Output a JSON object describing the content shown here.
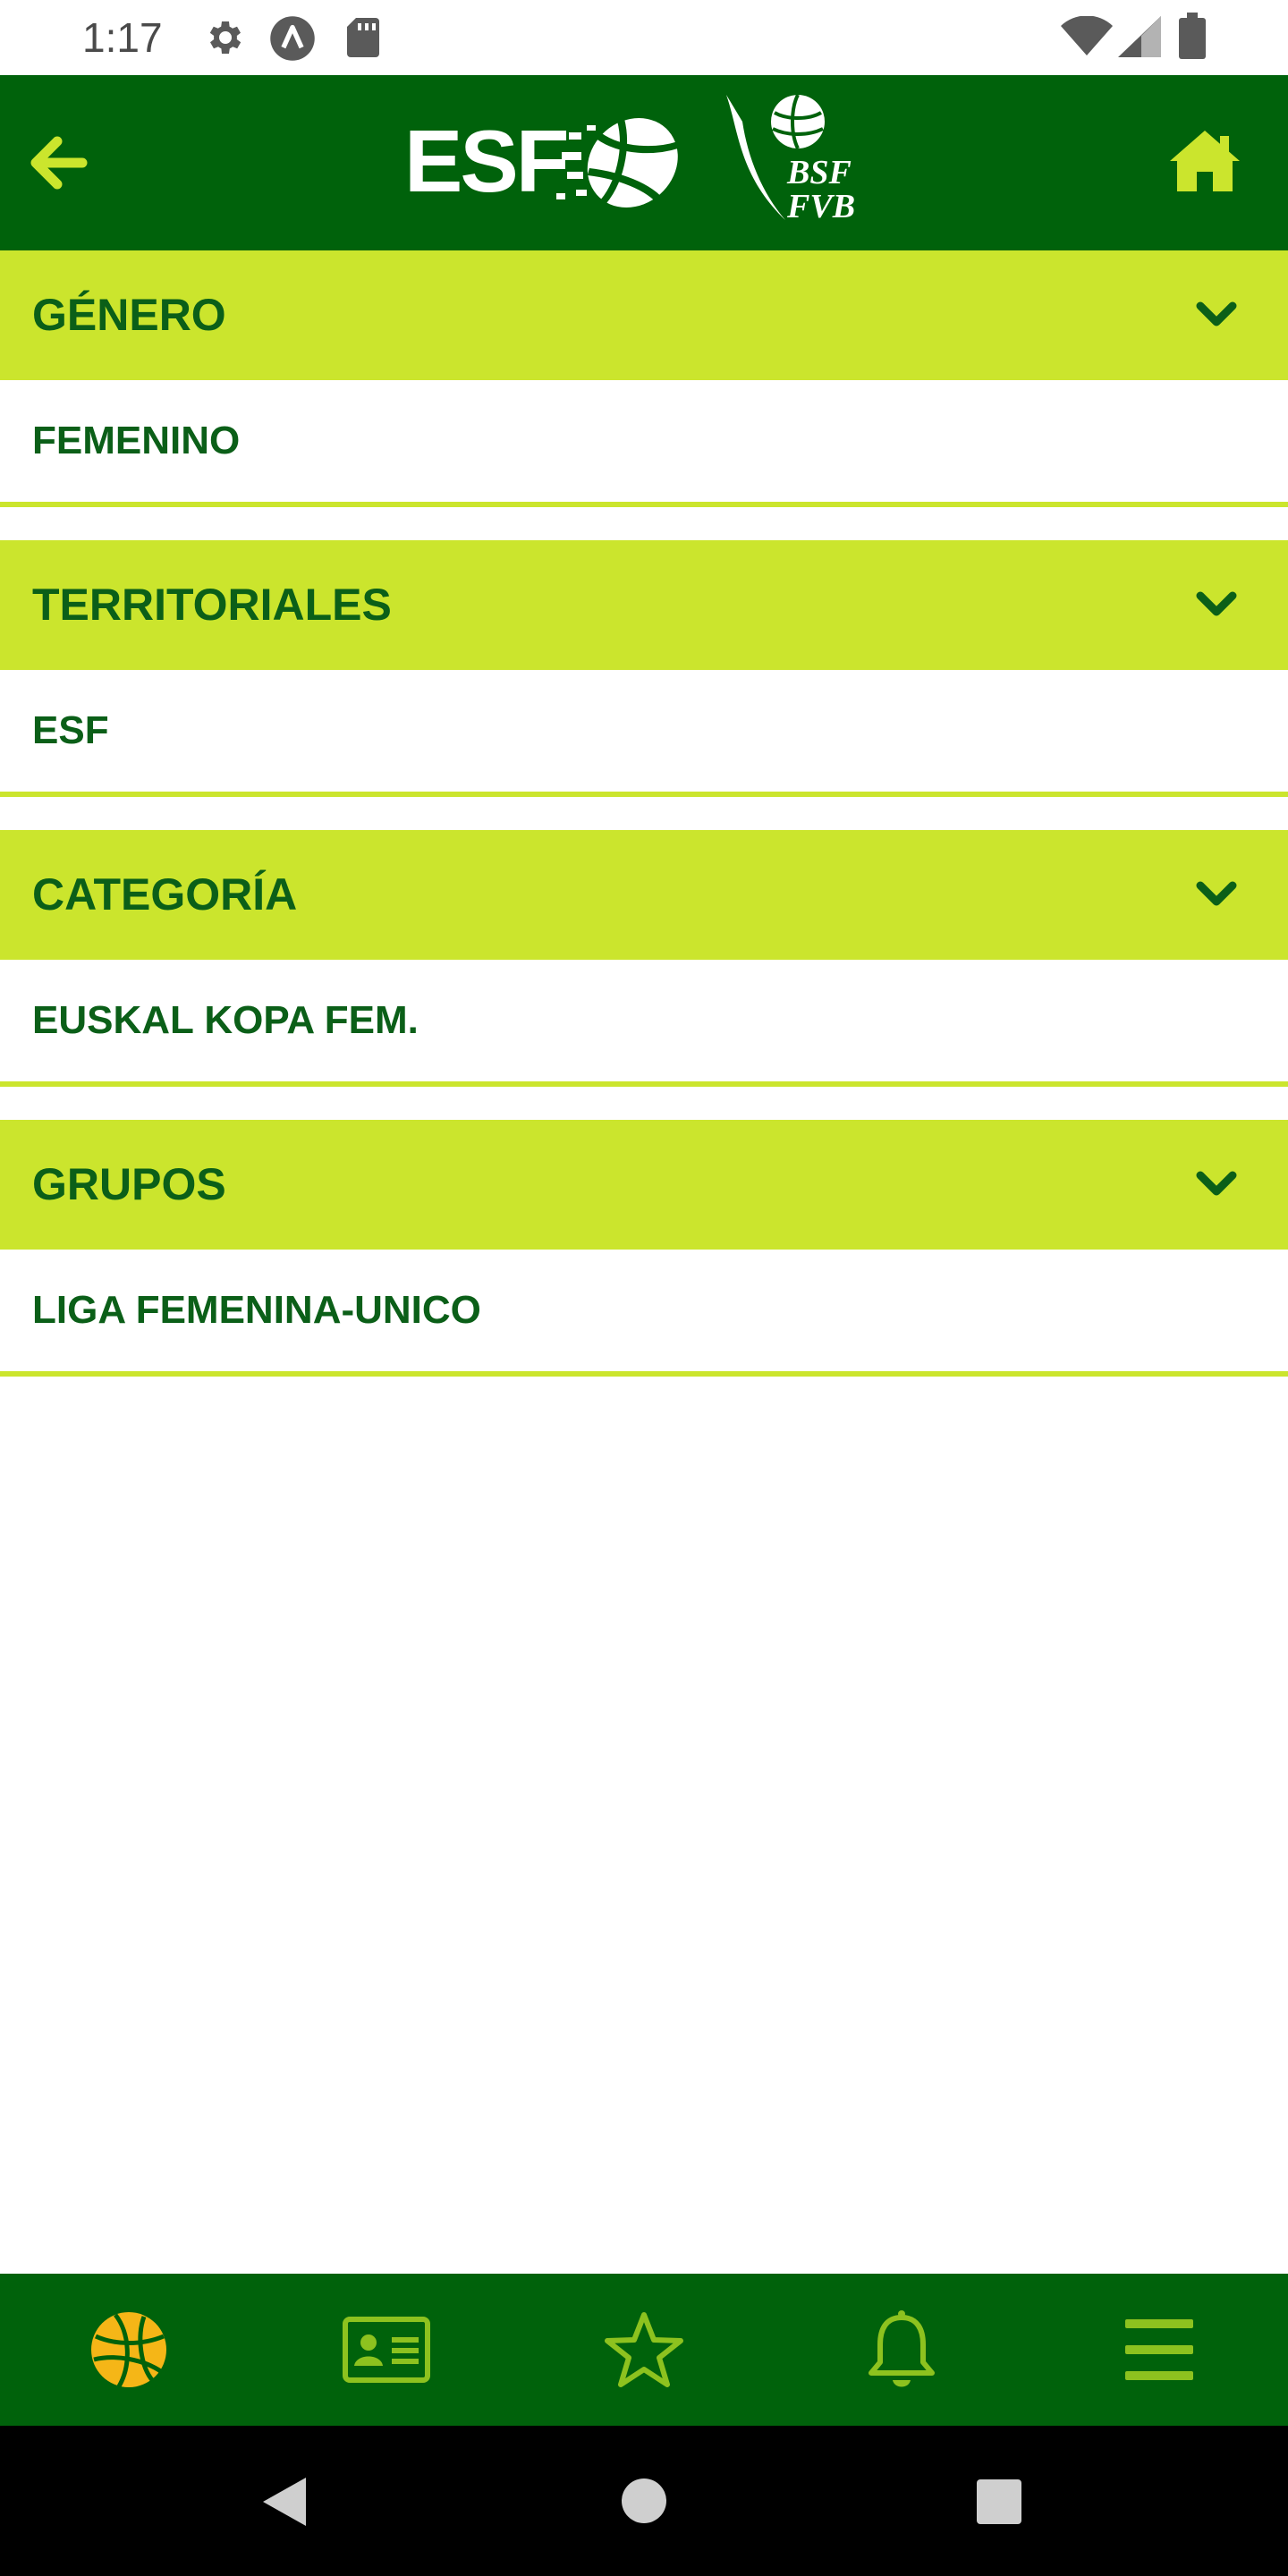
{
  "status_bar": {
    "time": "1:17",
    "icons_left": [
      "settings-icon",
      "a-badge-icon",
      "sd-card-icon"
    ],
    "icons_right": [
      "wifi-icon",
      "signal-icon",
      "battery-icon"
    ]
  },
  "header": {
    "back_icon": "arrow-left-icon",
    "logo_text": "ESF",
    "federation_logo": "BSF FVB",
    "home_icon": "home-icon",
    "colors": {
      "bar": "#00620b",
      "accent": "#cbe52d"
    }
  },
  "sections": [
    {
      "title": "GÉNERO",
      "value": "FEMENINO"
    },
    {
      "title": "TERRITORIALES",
      "value": "ESF"
    },
    {
      "title": "CATEGORÍA",
      "value": "EUSKAL KOPA FEM."
    },
    {
      "title": "GRUPOS",
      "value": "LIGA FEMENINA-UNICO"
    }
  ],
  "bottom_nav": {
    "items": [
      {
        "icon": "basketball-icon",
        "active": true
      },
      {
        "icon": "id-card-icon",
        "active": false
      },
      {
        "icon": "star-icon",
        "active": false
      },
      {
        "icon": "bell-icon",
        "active": false
      },
      {
        "icon": "menu-icon",
        "active": false
      }
    ],
    "colors": {
      "active": "#f5b617",
      "inactive": "#8dc21f"
    }
  },
  "system_nav": [
    "back-triangle-icon",
    "home-circle-icon",
    "recents-square-icon"
  ]
}
